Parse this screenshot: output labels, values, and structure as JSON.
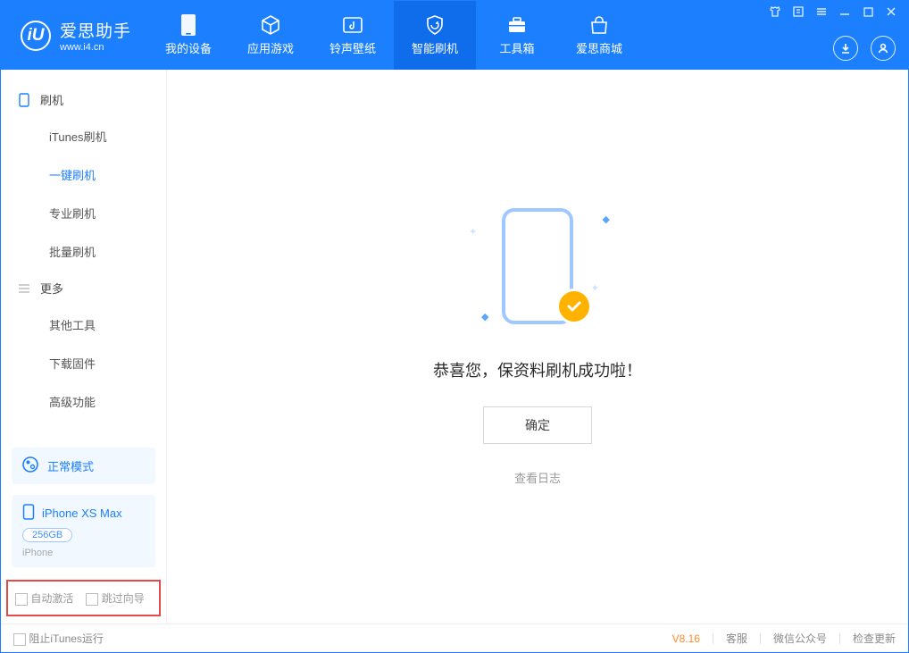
{
  "app": {
    "name": "爱思助手",
    "url": "www.i4.cn"
  },
  "header_tabs": [
    {
      "label": "我的设备"
    },
    {
      "label": "应用游戏"
    },
    {
      "label": "铃声壁纸"
    },
    {
      "label": "智能刷机"
    },
    {
      "label": "工具箱"
    },
    {
      "label": "爱思商城"
    }
  ],
  "sidebar": {
    "section1": "刷机",
    "items1": [
      "iTunes刷机",
      "一键刷机",
      "专业刷机",
      "批量刷机"
    ],
    "section2": "更多",
    "items2": [
      "其他工具",
      "下载固件",
      "高级功能"
    ],
    "mode": "正常模式",
    "device": {
      "name": "iPhone XS Max",
      "capacity": "256GB",
      "type": "iPhone"
    },
    "opts": {
      "a": "自动激活",
      "b": "跳过向导"
    }
  },
  "main": {
    "message": "恭喜您，保资料刷机成功啦！",
    "ok": "确定",
    "log": "查看日志"
  },
  "footer": {
    "block_itunes": "阻止iTunes运行",
    "version": "V8.16",
    "cs": "客服",
    "wx": "微信公众号",
    "update": "检查更新"
  }
}
